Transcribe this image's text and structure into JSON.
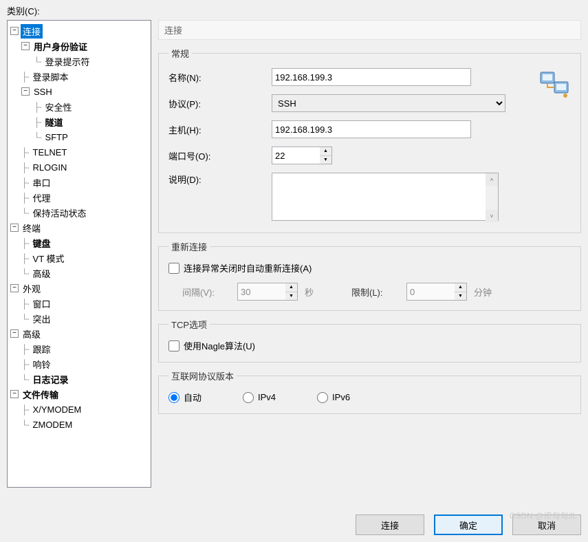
{
  "category_label": "类别(C):",
  "panel_title": "连接",
  "tree": {
    "root": "连接",
    "auth": "用户身份验证",
    "login_prompt": "登录提示符",
    "login_script": "登录脚本",
    "ssh": "SSH",
    "security": "安全性",
    "tunnel": "隧道",
    "sftp": "SFTP",
    "telnet": "TELNET",
    "rlogin": "RLOGIN",
    "serial": "串口",
    "proxy": "代理",
    "keepalive": "保持活动状态",
    "terminal": "终端",
    "keyboard": "键盘",
    "vtmode": "VT 模式",
    "advanced_term": "高级",
    "appearance": "外观",
    "window": "窗口",
    "highlight": "突出",
    "advanced": "高级",
    "trace": "跟踪",
    "bell": "响铃",
    "logging": "日志记录",
    "file_transfer": "文件传输",
    "xymodem": "X/YMODEM",
    "zmodem": "ZMODEM"
  },
  "general": {
    "legend": "常规",
    "name_label": "名称(N):",
    "name_value": "192.168.199.3",
    "protocol_label": "协议(P):",
    "protocol_value": "SSH",
    "host_label": "主机(H):",
    "host_value": "192.168.199.3",
    "port_label": "端口号(O):",
    "port_value": "22",
    "desc_label": "说明(D):",
    "desc_value": ""
  },
  "reconnect": {
    "legend": "重新连接",
    "checkbox_label": "连接异常关闭时自动重新连接(A)",
    "interval_label": "间隔(V):",
    "interval_value": "30",
    "interval_unit": "秒",
    "limit_label": "限制(L):",
    "limit_value": "0",
    "limit_unit": "分钟"
  },
  "tcp": {
    "legend": "TCP选项",
    "nagle_label": "使用Nagle算法(U)"
  },
  "ipver": {
    "legend": "互联网协议版本",
    "auto": "自动",
    "ipv4": "IPv4",
    "ipv6": "IPv6"
  },
  "buttons": {
    "connect": "连接",
    "ok": "确定",
    "cancel": "取消"
  },
  "watermark": "CSDN @修勾勾JL"
}
